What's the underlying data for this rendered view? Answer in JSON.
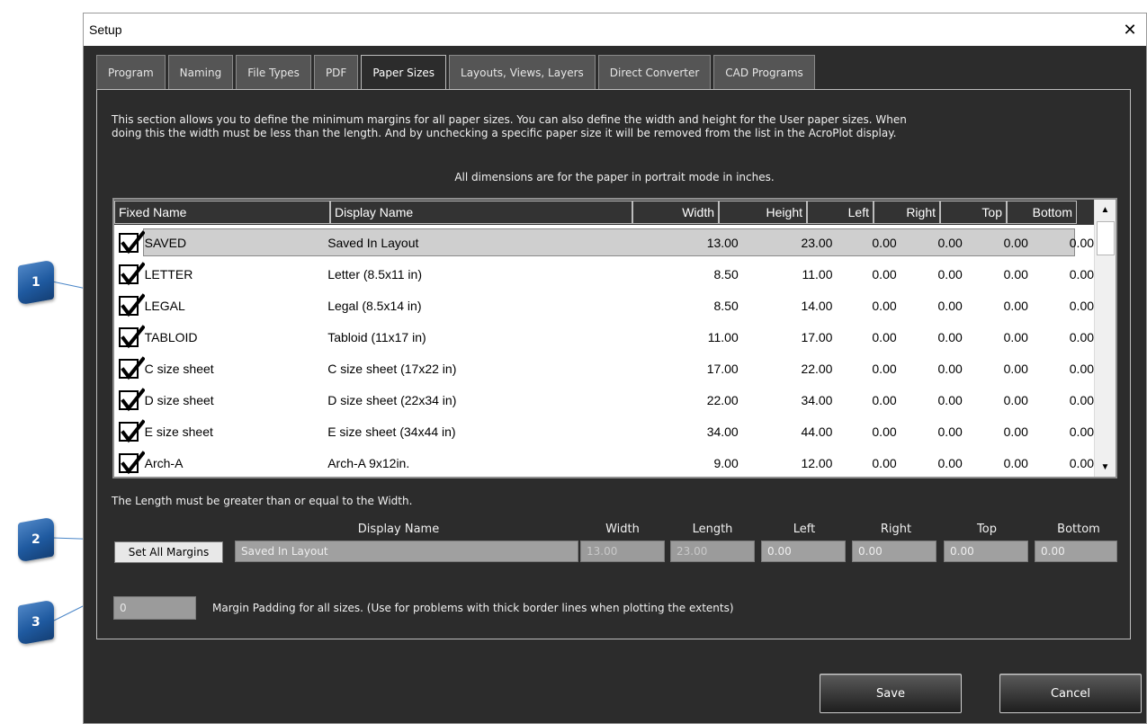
{
  "window": {
    "title": "Setup"
  },
  "tabs": [
    "Program",
    "Naming",
    "File Types",
    "PDF",
    "Paper Sizes",
    "Layouts, Views, Layers",
    "Direct Converter",
    "CAD Programs"
  ],
  "description": {
    "line1": "This section allows you to define the minimum margins for all paper sizes.  You can also define the width and height for the User paper sizes.  When",
    "line2": "doing this the width must be less than the length.  And by unchecking a specific paper size it will be removed from the list in the AcroPlot display.",
    "line3": "All dimensions are for the paper in portrait mode in inches."
  },
  "grid": {
    "headers": {
      "fixed": "Fixed Name",
      "display": "Display Name",
      "width": "Width",
      "height": "Height",
      "left": "Left",
      "right": "Right",
      "top": "Top",
      "bottom": "Bottom"
    },
    "rows": [
      {
        "fixed": "SAVED",
        "display": "Saved In Layout",
        "width": "13.00",
        "height": "23.00",
        "left": "0.00",
        "right": "0.00",
        "top": "0.00",
        "bottom": "0.00"
      },
      {
        "fixed": "LETTER",
        "display": "Letter (8.5x11 in)",
        "width": "8.50",
        "height": "11.00",
        "left": "0.00",
        "right": "0.00",
        "top": "0.00",
        "bottom": "0.00"
      },
      {
        "fixed": "LEGAL",
        "display": "Legal (8.5x14 in)",
        "width": "8.50",
        "height": "14.00",
        "left": "0.00",
        "right": "0.00",
        "top": "0.00",
        "bottom": "0.00"
      },
      {
        "fixed": "TABLOID",
        "display": "Tabloid (11x17 in)",
        "width": "11.00",
        "height": "17.00",
        "left": "0.00",
        "right": "0.00",
        "top": "0.00",
        "bottom": "0.00"
      },
      {
        "fixed": "C size sheet",
        "display": "C size sheet (17x22 in)",
        "width": "17.00",
        "height": "22.00",
        "left": "0.00",
        "right": "0.00",
        "top": "0.00",
        "bottom": "0.00"
      },
      {
        "fixed": "D size sheet",
        "display": "D size sheet (22x34 in)",
        "width": "22.00",
        "height": "34.00",
        "left": "0.00",
        "right": "0.00",
        "top": "0.00",
        "bottom": "0.00"
      },
      {
        "fixed": "E size sheet",
        "display": "E size sheet (34x44 in)",
        "width": "34.00",
        "height": "44.00",
        "left": "0.00",
        "right": "0.00",
        "top": "0.00",
        "bottom": "0.00"
      },
      {
        "fixed": "Arch-A",
        "display": "Arch-A 9x12in.",
        "width": "9.00",
        "height": "12.00",
        "left": "0.00",
        "right": "0.00",
        "top": "0.00",
        "bottom": "0.00"
      }
    ]
  },
  "note": "The Length must be greater than or equal to the Width.",
  "fields": {
    "labels": {
      "display": "Display Name",
      "width": "Width",
      "length": "Length",
      "left": "Left",
      "right": "Right",
      "top": "Top",
      "bottom": "Bottom"
    },
    "set_all_margins": "Set All Margins",
    "display_value": "Saved In Layout",
    "width_value": "13.00",
    "length_value": "23.00",
    "left_value": "0.00",
    "right_value": "0.00",
    "top_value": "0.00",
    "bottom_value": "0.00"
  },
  "padding": {
    "value": "0",
    "label": "Margin Padding for all sizes.  (Use for problems with thick border lines when plotting the extents)"
  },
  "buttons": {
    "save": "Save",
    "cancel": "Cancel"
  },
  "callouts": [
    "1",
    "2",
    "3"
  ],
  "colors": {
    "callout": "#1f5aa0",
    "callout_line": "#4a86c8",
    "callout_dot": "#d40000",
    "dialog_bg": "#2c2c2c"
  }
}
